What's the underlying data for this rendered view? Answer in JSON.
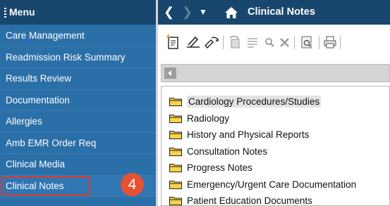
{
  "sidebar": {
    "title": "Menu",
    "items": [
      {
        "label": "Care Management"
      },
      {
        "label": "Readmission Risk Summary"
      },
      {
        "label": "Results Review"
      },
      {
        "label": "Documentation"
      },
      {
        "label": "Allergies"
      },
      {
        "label": "Amb EMR Order Req"
      },
      {
        "label": "Clinical Media"
      },
      {
        "label": "Clinical Notes",
        "active": true
      }
    ]
  },
  "step_badge": "4",
  "topbar": {
    "back_glyph": "❮",
    "forward_glyph": "❯",
    "dropdown_glyph": "▼",
    "home_icon": "home-icon",
    "title": "Clinical Notes"
  },
  "toolbar": {
    "icons": [
      "new-note-icon",
      "sign-icon",
      "forward-signature-icon",
      "modify-icon",
      "list-icon",
      "search-icon",
      "delete-icon",
      "preview-icon",
      "print-icon"
    ]
  },
  "folders": [
    {
      "label": "Cardiology Procedures/Studies"
    },
    {
      "label": "Radiology"
    },
    {
      "label": "History and Physical Reports"
    },
    {
      "label": "Consultation Notes"
    },
    {
      "label": "Progress Notes"
    },
    {
      "label": "Emergency/Urgent Care Documentation"
    },
    {
      "label": "Patient Education Documents"
    }
  ],
  "colors": {
    "sidebar_bg": "#2b6fa8",
    "header_bg": "#19466d",
    "highlight_border": "#e2372a",
    "badge": "#e55233",
    "folder_yellow": "#f6d24a"
  }
}
